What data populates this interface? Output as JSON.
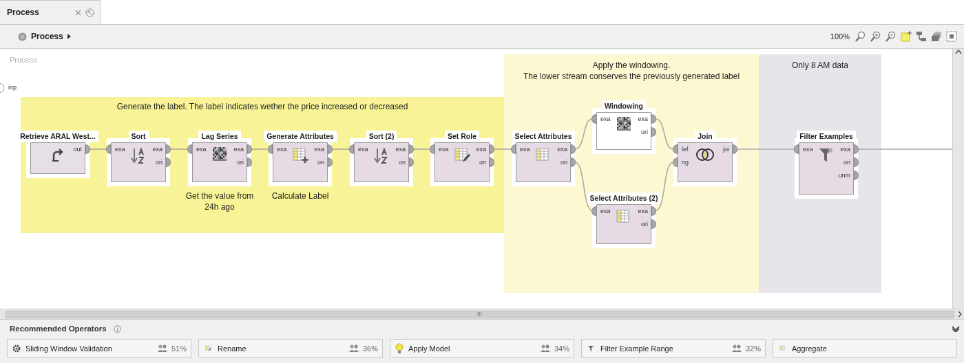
{
  "tab": {
    "title": "Process"
  },
  "breadcrumb": {
    "label": "Process"
  },
  "toolbar": {
    "zoom": "100%"
  },
  "canvas": {
    "label": "Process",
    "input_port": "inp",
    "annotations": [
      {
        "color": "#f7f396",
        "lines": [
          "Generate the label. The label indicates wether the price increased or decreased"
        ]
      },
      {
        "color": "#fcf8d2",
        "lines": [
          "Apply the windowing.",
          "The lower stream conserves the previously generated label"
        ]
      },
      {
        "color": "#e7e4ea",
        "lines": [
          "Only 8 AM data"
        ]
      }
    ],
    "operators": [
      {
        "name": "Retrieve ARAL West...",
        "color": "#e6dfe6",
        "outputs": [
          "out"
        ]
      },
      {
        "name": "Sort",
        "color": "#e6dae4",
        "inputs": [
          "exa"
        ],
        "outputs": [
          "exa",
          "ori"
        ]
      },
      {
        "name": "Lag Series",
        "color": "#e6dae4",
        "inputs": [
          "exa"
        ],
        "outputs": [
          "exa",
          "ori"
        ],
        "caption": "Get the value from 24h ago"
      },
      {
        "name": "Generate Attributes",
        "color": "#e6dae4",
        "inputs": [
          "exa"
        ],
        "outputs": [
          "exa",
          "ori"
        ],
        "caption": "Calculate Label"
      },
      {
        "name": "Sort (2)",
        "color": "#e6dae4",
        "inputs": [
          "exa"
        ],
        "outputs": [
          "exa",
          "ori"
        ]
      },
      {
        "name": "Set Role",
        "color": "#e6dae4",
        "inputs": [
          "exa"
        ],
        "outputs": [
          "exa",
          "ori"
        ]
      },
      {
        "name": "Select Attributes",
        "color": "#e6dae4",
        "inputs": [
          "exa"
        ],
        "outputs": [
          "exa",
          "ori"
        ]
      },
      {
        "name": "Windowing",
        "color": "#ffffff",
        "inputs": [
          "exa"
        ],
        "outputs": [
          "exa",
          "ori"
        ]
      },
      {
        "name": "Select Attributes (2)",
        "color": "#e6dae4",
        "inputs": [
          "exa"
        ],
        "outputs": [
          "exa",
          "ori"
        ]
      },
      {
        "name": "Join",
        "color": "#e6dae4",
        "inputs": [
          "lef",
          "rig"
        ],
        "outputs": [
          "joi"
        ]
      },
      {
        "name": "Filter Examples",
        "color": "#e6dae4",
        "inputs": [
          "exa"
        ],
        "outputs": [
          "exa",
          "ori",
          "unm"
        ]
      }
    ]
  },
  "recommended": {
    "title": "Recommended Operators",
    "items": [
      {
        "name": "Sliding Window Validation",
        "percent": "51%"
      },
      {
        "name": "Rename",
        "percent": "36%"
      },
      {
        "name": "Apply Model",
        "percent": "34%"
      },
      {
        "name": "Filter Example Range",
        "percent": "32%"
      },
      {
        "name": "Aggregate"
      }
    ]
  }
}
